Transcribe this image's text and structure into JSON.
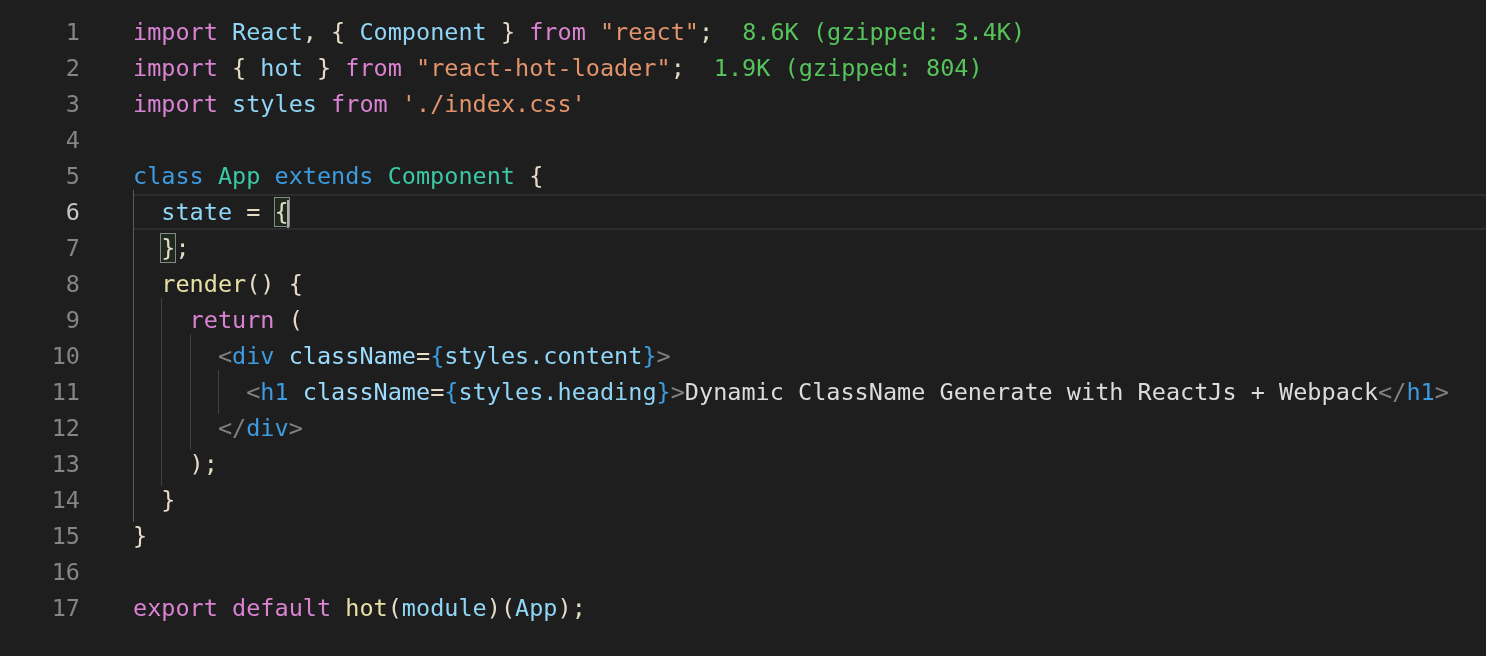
{
  "editor": {
    "lines": [
      {
        "number": "1",
        "current": false,
        "tokens": [
          {
            "kind": "keyword",
            "text": "import "
          },
          {
            "kind": "variable",
            "text": "React"
          },
          {
            "kind": "punct",
            "text": ", { "
          },
          {
            "kind": "variable",
            "text": "Component"
          },
          {
            "kind": "punct",
            "text": " } "
          },
          {
            "kind": "keyword",
            "text": "from "
          },
          {
            "kind": "string",
            "text": "\"react\""
          },
          {
            "kind": "punct",
            "text": ";"
          }
        ],
        "annotation": "8.6K (gzipped: 3.4K)"
      },
      {
        "number": "2",
        "current": false,
        "tokens": [
          {
            "kind": "keyword",
            "text": "import"
          },
          {
            "kind": "punct",
            "text": " { "
          },
          {
            "kind": "variable",
            "text": "hot"
          },
          {
            "kind": "punct",
            "text": " } "
          },
          {
            "kind": "keyword",
            "text": "from "
          },
          {
            "kind": "string",
            "text": "\"react-hot-loader\""
          },
          {
            "kind": "punct",
            "text": ";"
          }
        ],
        "annotation": "1.9K (gzipped: 804)"
      },
      {
        "number": "3",
        "current": false,
        "tokens": [
          {
            "kind": "keyword",
            "text": "import "
          },
          {
            "kind": "variable",
            "text": "styles "
          },
          {
            "kind": "keyword",
            "text": "from "
          },
          {
            "kind": "string",
            "text": "'./index.css'"
          }
        ]
      },
      {
        "number": "4",
        "current": false
      },
      {
        "number": "5",
        "current": false,
        "tokens": [
          {
            "kind": "storage",
            "text": "class "
          },
          {
            "kind": "type",
            "text": "App "
          },
          {
            "kind": "storage",
            "text": "extends "
          },
          {
            "kind": "type",
            "text": "Component"
          },
          {
            "kind": "punct",
            "text": " {"
          }
        ]
      },
      {
        "number": "6",
        "current": true,
        "tokens": [
          {
            "kind": "variable",
            "text": "  state"
          },
          {
            "kind": "punct",
            "text": " = "
          },
          {
            "kind": "punct",
            "text": "{",
            "matched": true,
            "cursor": true
          }
        ]
      },
      {
        "number": "7",
        "current": false,
        "tokens": [
          {
            "kind": "punct",
            "text": "  }",
            "matched": true
          },
          {
            "kind": "punct",
            "text": ";"
          }
        ]
      },
      {
        "number": "8",
        "current": false,
        "tokens": [
          {
            "kind": "function",
            "text": "  render"
          },
          {
            "kind": "punct",
            "text": "() {"
          }
        ]
      },
      {
        "number": "9",
        "current": false,
        "tokens": [
          {
            "kind": "keyword",
            "text": "    return"
          },
          {
            "kind": "punct",
            "text": " ("
          }
        ]
      },
      {
        "number": "10",
        "current": false,
        "tokens": [
          {
            "kind": "tagpunct",
            "text": "      <"
          },
          {
            "kind": "tag",
            "text": "div "
          },
          {
            "kind": "attr",
            "text": "className"
          },
          {
            "kind": "punct",
            "text": "="
          },
          {
            "kind": "tag",
            "text": "{"
          },
          {
            "kind": "variable",
            "text": "styles.content"
          },
          {
            "kind": "tag",
            "text": "}"
          },
          {
            "kind": "tagpunct",
            "text": ">"
          }
        ]
      },
      {
        "number": "11",
        "current": false,
        "tokens": [
          {
            "kind": "tagpunct",
            "text": "        <"
          },
          {
            "kind": "tag",
            "text": "h1 "
          },
          {
            "kind": "attr",
            "text": "className"
          },
          {
            "kind": "punct",
            "text": "="
          },
          {
            "kind": "tag",
            "text": "{"
          },
          {
            "kind": "variable",
            "text": "styles.heading"
          },
          {
            "kind": "tag",
            "text": "}"
          },
          {
            "kind": "tagpunct",
            "text": ">"
          },
          {
            "kind": "text",
            "text": "Dynamic ClassName Generate with ReactJs + Webpack"
          },
          {
            "kind": "tagpunct",
            "text": "</"
          },
          {
            "kind": "tag",
            "text": "h1"
          },
          {
            "kind": "tagpunct",
            "text": ">"
          }
        ]
      },
      {
        "number": "12",
        "current": false,
        "tokens": [
          {
            "kind": "tagpunct",
            "text": "      </"
          },
          {
            "kind": "tag",
            "text": "div"
          },
          {
            "kind": "tagpunct",
            "text": ">"
          }
        ]
      },
      {
        "number": "13",
        "current": false,
        "tokens": [
          {
            "kind": "punct",
            "text": "    );"
          }
        ]
      },
      {
        "number": "14",
        "current": false,
        "tokens": [
          {
            "kind": "punct",
            "text": "  }"
          }
        ]
      },
      {
        "number": "15",
        "current": false,
        "tokens": [
          {
            "kind": "punct",
            "text": "}"
          }
        ]
      },
      {
        "number": "16",
        "current": false
      },
      {
        "number": "17",
        "current": false,
        "tokens": [
          {
            "kind": "keyword",
            "text": "export "
          },
          {
            "kind": "keyword",
            "text": "default "
          },
          {
            "kind": "function",
            "text": "hot"
          },
          {
            "kind": "punct",
            "text": "("
          },
          {
            "kind": "variable",
            "text": "module"
          },
          {
            "kind": "punct",
            "text": ")("
          },
          {
            "kind": "variable",
            "text": "App"
          },
          {
            "kind": "punct",
            "text": ");"
          }
        ]
      }
    ]
  }
}
